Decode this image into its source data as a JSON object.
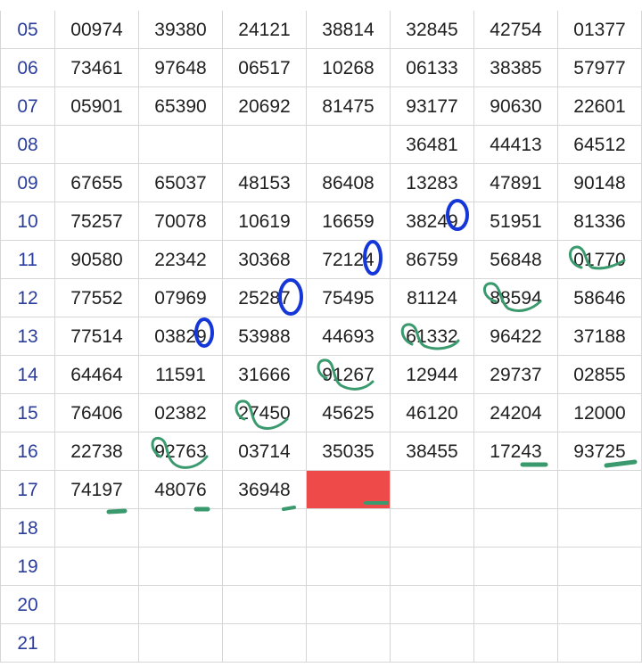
{
  "sheet": {
    "rows": [
      {
        "label": "05",
        "cells": [
          "00974",
          "39380",
          "24121",
          "38814",
          "32845",
          "42754",
          "01377"
        ]
      },
      {
        "label": "06",
        "cells": [
          "73461",
          "97648",
          "06517",
          "10268",
          "06133",
          "38385",
          "57977"
        ]
      },
      {
        "label": "07",
        "cells": [
          "05901",
          "65390",
          "20692",
          "81475",
          "93177",
          "90630",
          "22601"
        ]
      },
      {
        "label": "08",
        "cells": [
          "",
          "",
          "",
          "",
          "36481",
          "44413",
          "64512"
        ]
      },
      {
        "label": "09",
        "cells": [
          "67655",
          "65037",
          "48153",
          "86408",
          "13283",
          "47891",
          "90148"
        ]
      },
      {
        "label": "10",
        "cells": [
          "75257",
          "70078",
          "10619",
          "16659",
          "38249",
          "51951",
          "81336"
        ]
      },
      {
        "label": "11",
        "cells": [
          "90580",
          "22342",
          "30368",
          "72124",
          "86759",
          "56848",
          "01770"
        ]
      },
      {
        "label": "12",
        "cells": [
          "77552",
          "07969",
          "25287",
          "75495",
          "81124",
          "88594",
          "58646"
        ]
      },
      {
        "label": "13",
        "cells": [
          "77514",
          "03829",
          "53988",
          "44693",
          "61332",
          "96422",
          "37188"
        ]
      },
      {
        "label": "14",
        "cells": [
          "64464",
          "11591",
          "31666",
          "91267",
          "12944",
          "29737",
          "02855"
        ]
      },
      {
        "label": "15",
        "cells": [
          "76406",
          "02382",
          "27450",
          "45625",
          "46120",
          "24204",
          "12000"
        ]
      },
      {
        "label": "16",
        "cells": [
          "22738",
          "92763",
          "03714",
          "35035",
          "38455",
          "17243",
          "93725"
        ]
      },
      {
        "label": "17",
        "cells": [
          "74197",
          "48076",
          "36948",
          "",
          "",
          "",
          ""
        ]
      },
      {
        "label": "18",
        "cells": [
          "",
          "",
          "",
          "",
          "",
          "",
          ""
        ]
      },
      {
        "label": "19",
        "cells": [
          "",
          "",
          "",
          "",
          "",
          "",
          ""
        ]
      },
      {
        "label": "20",
        "cells": [
          "",
          "",
          "",
          "",
          "",
          "",
          ""
        ]
      },
      {
        "label": "21",
        "cells": [
          "",
          "",
          "",
          "",
          "",
          "",
          ""
        ]
      }
    ],
    "highlight_color": "#ef4a4a",
    "row_label_color": "#2b3e9c",
    "grid_line_color": "#d6d6d6",
    "annotation_blue": "#1537d8",
    "annotation_green": "#3a9a6e"
  }
}
